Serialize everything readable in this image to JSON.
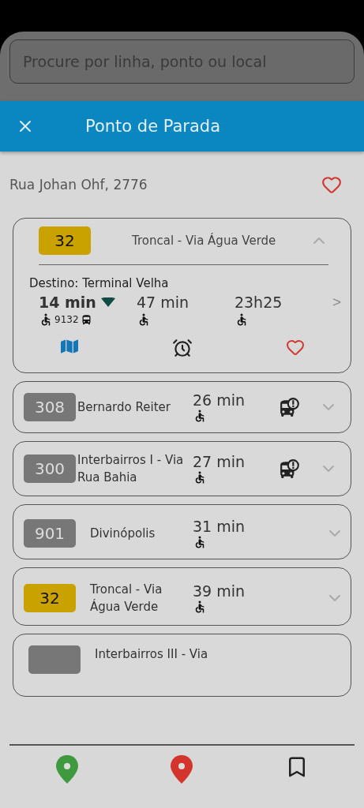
{
  "search": {
    "placeholder": "Procure por linha, ponto ou local"
  },
  "header": {
    "title": "Ponto de Parada"
  },
  "stop": {
    "address": "Rua Johan Ohf, 2776"
  },
  "routes": [
    {
      "kind": "expanded",
      "number": "32",
      "color": "#c9a200",
      "name": "Troncal - Via Água Verde",
      "destination": "Destino: Terminal Velha",
      "arrivals": [
        {
          "time": "14 min",
          "realtime": true,
          "vehicle": "9132"
        },
        {
          "time": "47 min",
          "realtime": false
        },
        {
          "time": "23h25",
          "realtime": false
        }
      ],
      "more": ">"
    },
    {
      "kind": "collapsed",
      "number": "308",
      "color": "#777777",
      "name": "Bernardo Reiter",
      "time": "26 min",
      "alert": true
    },
    {
      "kind": "collapsed",
      "number": "300",
      "color": "#777777",
      "name": "Interbairros I - Via Rua Bahia",
      "time": "27 min",
      "alert": true
    },
    {
      "kind": "collapsed",
      "number": "901",
      "color": "#777777",
      "name": "Divinópolis",
      "time": "31 min",
      "alert": false
    },
    {
      "kind": "collapsed",
      "number": "32",
      "color": "#c9a200",
      "name": "Troncal - Via Água Verde",
      "time": "39 min",
      "alert": false
    },
    {
      "kind": "partial",
      "color": "#777777",
      "name": "Interbairros III - Via"
    }
  ]
}
